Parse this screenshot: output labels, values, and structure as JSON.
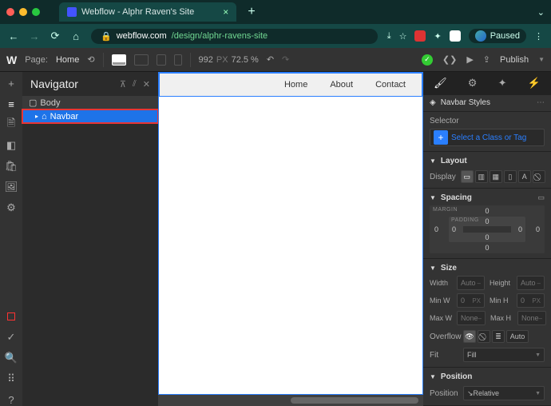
{
  "browser": {
    "tab_title": "Webflow - Alphr Raven's Site",
    "host": "webflow.com",
    "path": "/design/alphr-ravens-site",
    "paused": "Paused"
  },
  "apptb": {
    "page_label": "Page:",
    "page_name": "Home",
    "width_px": "992",
    "px": "PX",
    "zoom": "72.5 %",
    "publish": "Publish"
  },
  "nav": {
    "title": "Navigator",
    "body": "Body",
    "navbar": "Navbar"
  },
  "canvas": {
    "links": [
      "Home",
      "About",
      "Contact"
    ]
  },
  "styles": {
    "header": "Navbar Styles",
    "selector_label": "Selector",
    "selector_ph": "Select a Class or Tag",
    "layout": "Layout",
    "display": "Display",
    "spacing": "Spacing",
    "margin": "MARGIN",
    "padding": "PADDING",
    "zero": "0",
    "size": "Size",
    "width": "Width",
    "height": "Height",
    "minw": "Min W",
    "minh": "Min H",
    "maxw": "Max W",
    "maxh": "Max H",
    "auto": "Auto",
    "none": "None",
    "px2": "PX",
    "overflow": "Overflow",
    "fit": "Fit",
    "fill": "Fill",
    "position": "Position",
    "position_v": "Relative"
  }
}
